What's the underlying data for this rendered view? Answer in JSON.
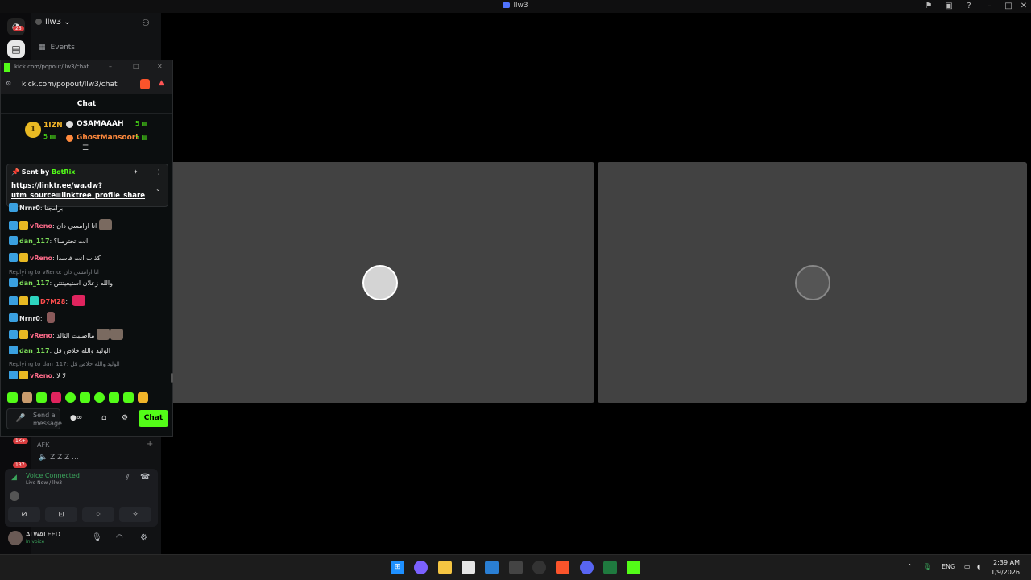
{
  "window": {
    "title": "llw3",
    "controls": [
      "pin-icon",
      "screen-icon",
      "help-icon",
      "minimize",
      "maximize",
      "close"
    ]
  },
  "discord": {
    "server_name": "llw3",
    "notification_badge": "25",
    "events_label": "Events",
    "afk_channel": "AFK",
    "vc_user_status": "Z Z Z",
    "badges": {
      "first": "1K+",
      "second": "137"
    },
    "voice_panel": {
      "status": "Voice Connected",
      "channel": "Live Now / llw3"
    },
    "user": {
      "name": "ALWALEED",
      "status": "In voice"
    }
  },
  "kick": {
    "window_title": "kick.com/popout/llw3/chat...",
    "url": "kick.com/popout/llw3/chat",
    "chat_header": "Chat",
    "leaderboard": {
      "rank": "1",
      "top_user": "1IZN",
      "top_count": "5",
      "second_user": "OSAMAAAH",
      "second_count": "5",
      "third_user": "GhostMansoori",
      "third_count": "5"
    },
    "pinned": {
      "sent_by_label": "Sent by",
      "bot_name": "BotRix",
      "link_line1": "https://linktr.ee/wa.dw?",
      "link_line2": "utm_source=linktree_profile_share"
    },
    "messages": [
      {
        "user": "Nrnr0",
        "color": "#e6e6e6",
        "text": "برامجنا"
      },
      {
        "user": "vReno",
        "color": "#ff6b8a",
        "text": "انا ارامسي دان"
      },
      {
        "user": "dan_117",
        "color": "#7ee05a",
        "text": "انت تحترمنا؟"
      },
      {
        "user": "vReno",
        "color": "#ff6b8a",
        "text": "كذاب انت فاسدا"
      },
      {
        "user": "dan_117",
        "color": "#7ee05a",
        "text": "والله زعلان استيعيتتتن",
        "reply": "Replying to vReno: انا ارامسي دان"
      },
      {
        "user": "D7M28",
        "color": "#ff4d4d",
        "text": ""
      },
      {
        "user": "Nrnr0",
        "color": "#e6e6e6",
        "text": ""
      },
      {
        "user": "vReno",
        "color": "#ff6b8a",
        "text": "مااصبيت الثالد"
      },
      {
        "user": "dan_117",
        "color": "#7ee05a",
        "text": "الوليد والله خلاص قل"
      },
      {
        "user": "vReno",
        "color": "#ff6b8a",
        "text": "لا لا",
        "reply": "Replying to dan_117: الوليد والله خلاص قل"
      }
    ],
    "input_placeholder": "Send a message",
    "chat_button": "Chat"
  },
  "taskbar": {
    "language": "ENG",
    "time": "2:39 AM",
    "date": "1/9/2026"
  }
}
